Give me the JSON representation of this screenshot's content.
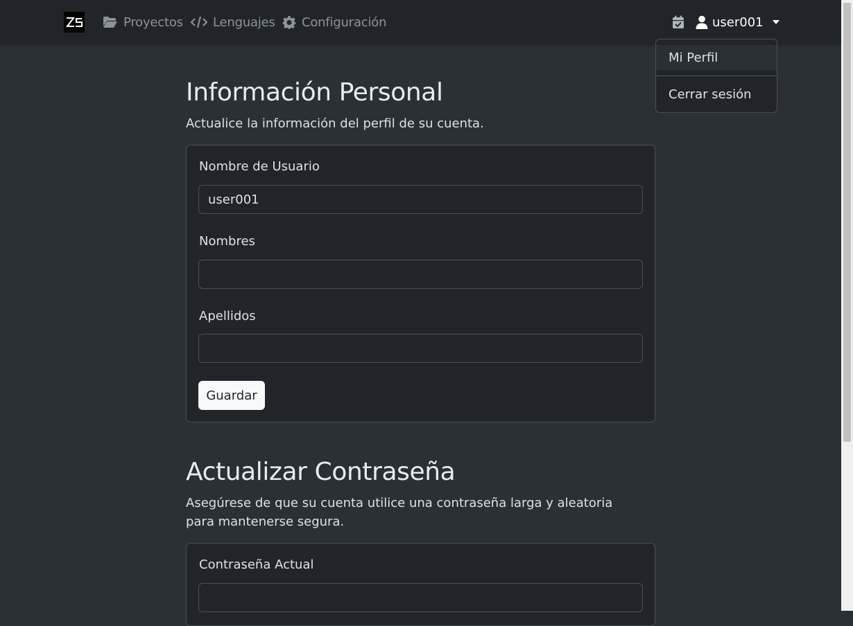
{
  "navbar": {
    "brand_logo": "ZS",
    "links": [
      {
        "label": "Proyectos",
        "icon": "folder-open-icon"
      },
      {
        "label": "Lenguajes",
        "icon": "code-icon"
      },
      {
        "label": "Configuración",
        "icon": "gear-icon"
      }
    ],
    "calendar_icon": "calendar-check-icon",
    "user": {
      "label": "user001",
      "icon": "user-icon"
    }
  },
  "dropdown": {
    "items": [
      {
        "label": "Mi Perfil"
      },
      {
        "label": "Cerrar sesión"
      }
    ]
  },
  "profile_section": {
    "title": "Información Personal",
    "description": "Actualice la información del perfil de su cuenta.",
    "fields": [
      {
        "label": "Nombre de Usuario",
        "value": "user001"
      },
      {
        "label": "Nombres",
        "value": ""
      },
      {
        "label": "Apellidos",
        "value": ""
      }
    ],
    "save_label": "Guardar"
  },
  "password_section": {
    "title": "Actualizar Contraseña",
    "description": "Asegúrese de que su cuenta utilice una contraseña larga y aleatoria para mantenerse segura.",
    "fields": [
      {
        "label": "Contraseña Actual",
        "value": ""
      }
    ]
  },
  "colors": {
    "background": "#2b3035",
    "navbar": "#212529",
    "card": "#212529",
    "border": "#495057",
    "button": "#f8f9fa"
  }
}
